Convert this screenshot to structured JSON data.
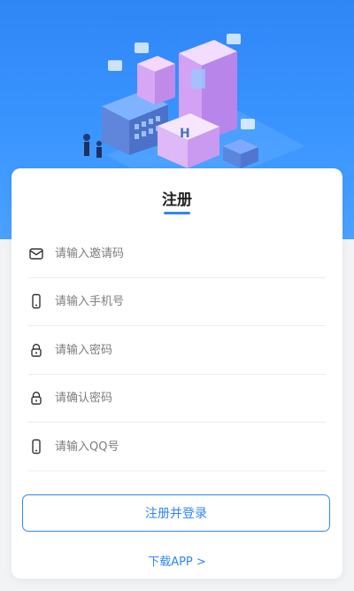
{
  "page": {
    "title": "注册"
  },
  "form": {
    "invite_code_placeholder": "请输入邀请码",
    "phone_placeholder": "请输入手机号",
    "password_placeholder": "请输入密码",
    "confirm_password_placeholder": "请确认密码",
    "qq_placeholder": "请输入QQ号"
  },
  "actions": {
    "register_login_label": "注册并登录",
    "download_app_label": "下载APP >"
  },
  "theme": {
    "accent": "#2f86f6",
    "background": "#f2f3f5"
  },
  "icons": {
    "invite": "envelope-icon",
    "phone": "phone-icon",
    "password": "lock-icon",
    "confirm": "lock-icon",
    "qq": "phone-icon"
  }
}
